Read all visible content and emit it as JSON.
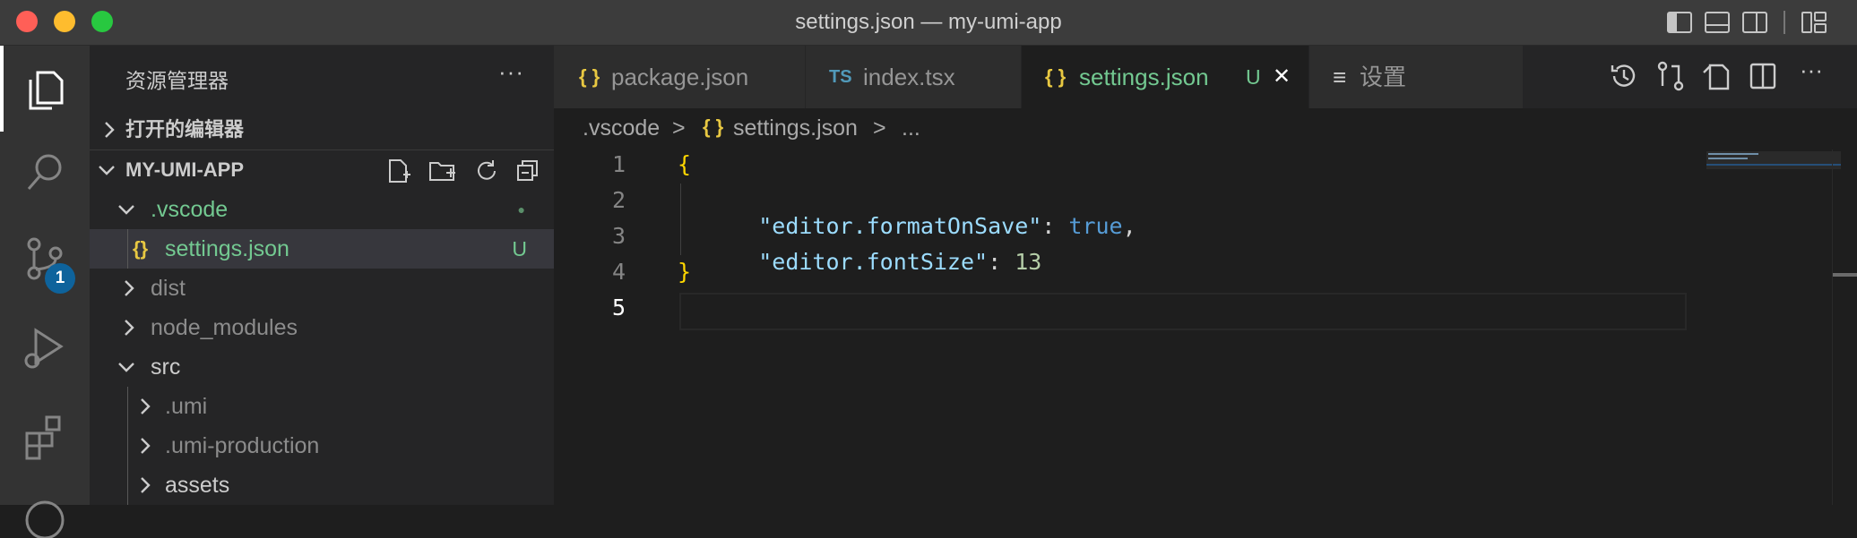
{
  "window": {
    "title": "settings.json — my-umi-app"
  },
  "activity_bar": {
    "scm_badge": "1"
  },
  "sidebar": {
    "title": "资源管理器",
    "more": "···",
    "open_editors": "打开的编辑器",
    "project": "MY-UMI-APP",
    "tree": [
      {
        "label": ".vscode",
        "status": "●"
      },
      {
        "label": "settings.json",
        "icon": "{}",
        "status": "U"
      },
      {
        "label": "dist"
      },
      {
        "label": "node_modules"
      },
      {
        "label": "src"
      },
      {
        "label": ".umi"
      },
      {
        "label": ".umi-production"
      },
      {
        "label": "assets"
      }
    ]
  },
  "tabs": [
    {
      "icon": "{ }",
      "label": "package.json"
    },
    {
      "icon": "TS",
      "label": "index.tsx"
    },
    {
      "icon": "{ }",
      "label": "settings.json",
      "status": "U",
      "close": "✕"
    },
    {
      "icon": "≡",
      "label": "设置"
    }
  ],
  "toolbar": {
    "more": "···"
  },
  "breadcrumb": {
    "folder": ".vscode",
    "sep": ">",
    "icon": "{ }",
    "file": "settings.json",
    "sep2": ">",
    "rest": "..."
  },
  "editor": {
    "lines": [
      "1",
      "2",
      "3",
      "4",
      "5"
    ],
    "code": {
      "open": "{",
      "key1": "\"editor.formatOnSave\"",
      "colon1": ": ",
      "val1": "true",
      "comma1": ",",
      "key2": "\"editor.fontSize\"",
      "colon2": ": ",
      "val2": "13",
      "close": "}"
    }
  },
  "colors": {
    "accent": "#0e639c",
    "untracked": "#73c991",
    "json_icon": "#e8c842",
    "ts_icon": "#519aba"
  }
}
